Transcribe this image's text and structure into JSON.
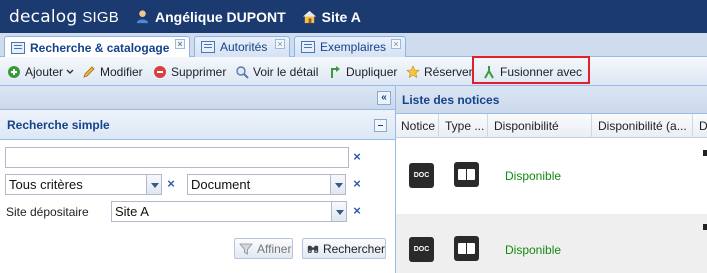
{
  "header": {
    "brand": "decalog",
    "product": "SIGB",
    "user": "Angélique DUPONT",
    "site": "Site A"
  },
  "tabs": [
    {
      "label": "Recherche & catalogage",
      "active": true
    },
    {
      "label": "Autorités",
      "active": false
    },
    {
      "label": "Exemplaires",
      "active": false
    }
  ],
  "toolbar": {
    "add": "Ajouter",
    "edit": "Modifier",
    "delete": "Supprimer",
    "view": "Voir le détail",
    "duplicate": "Dupliquer",
    "reserve": "Réserver",
    "merge": "Fusionner avec"
  },
  "search": {
    "collapse_glyph": "«",
    "section_title": "Recherche simple",
    "query_value": "",
    "criteria_value": "Tous critères",
    "doc_type_value": "Document",
    "site_label": "Site dépositaire",
    "site_value": "Site A",
    "refine_label": "Affiner",
    "search_label": "Rechercher",
    "clear_glyph": "×"
  },
  "results": {
    "title": "Liste des notices",
    "columns": [
      "Notice",
      "Type ...",
      "Disponibilité",
      "Disponibilité (a...",
      "De"
    ],
    "rows": [
      {
        "doc_badge": "DOC",
        "availability": "Disponible"
      },
      {
        "doc_badge": "DOC",
        "availability": "Disponible"
      }
    ]
  },
  "colors": {
    "header_bg": "#1b3a6f",
    "accent_title": "#15428b",
    "available_green": "#138a12",
    "highlight_red": "#e0202a"
  }
}
